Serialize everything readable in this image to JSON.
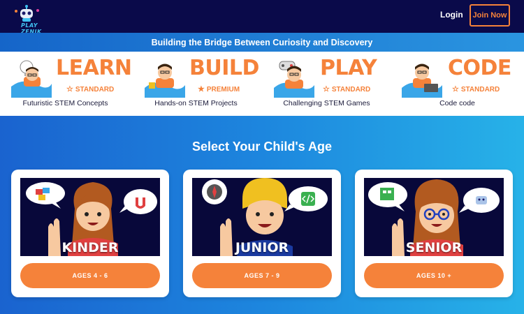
{
  "header": {
    "logo_text": "PLAY ZENIK",
    "login_label": "Login",
    "join_label": "Join Now"
  },
  "banner": {
    "text": "Building the Bridge Between Curiosity and Discovery"
  },
  "features": [
    {
      "title": "LEARN",
      "tier": "STANDARD",
      "tier_icon": "star-outline-icon",
      "description": "Futuristic STEM Concepts"
    },
    {
      "title": "BUILD",
      "tier": "PREMIUM",
      "tier_icon": "star-filled-icon",
      "description": "Hands-on STEM Projects"
    },
    {
      "title": "PLAY",
      "tier": "STANDARD",
      "tier_icon": "star-outline-icon",
      "description": "Challenging STEM Games"
    },
    {
      "title": "CODE",
      "tier": "STANDARD",
      "tier_icon": "star-outline-icon",
      "description": "Code code"
    }
  ],
  "age_section": {
    "title": "Select Your Child's Age",
    "cards": [
      {
        "label": "KINDER",
        "button": "AGES 4 - 6"
      },
      {
        "label": "JUNIOR",
        "button": "AGES 7 - 9"
      },
      {
        "label": "SENIOR",
        "button": "AGES 10 +"
      }
    ]
  },
  "colors": {
    "header_bg": "#0a0a4a",
    "accent_orange": "#f5823a",
    "banner_blue": "#1565c9",
    "scene_bg": "#08083a"
  }
}
